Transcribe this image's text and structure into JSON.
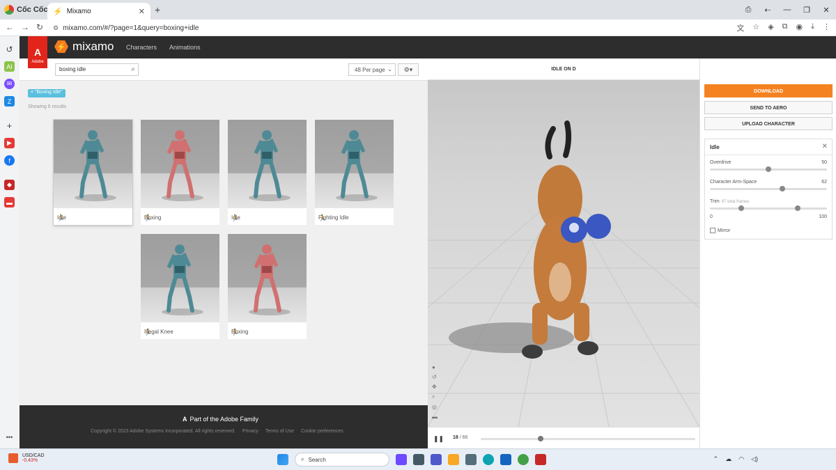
{
  "browser": {
    "brand": "Cốc Cốc",
    "tab_title": "Mixamo",
    "url": "mixamo.com/#/?page=1&query=boxing+idle"
  },
  "mixamo": {
    "adobe_label": "Adobe",
    "logo_text": "mixamo",
    "nav": [
      "Characters",
      "Animations"
    ]
  },
  "search": {
    "query": "boxing idle",
    "per_page": "48 Per page",
    "filter_chip": "× \"Boxing Idle\"",
    "result_count": "Showing 6 results"
  },
  "results": [
    {
      "label": "Idle",
      "tone": "teal"
    },
    {
      "label": "Boxing",
      "tone": "red"
    },
    {
      "label": "Idle",
      "tone": "teal"
    },
    {
      "label": "Fighting Idle",
      "tone": "teal"
    },
    {
      "label": "Illegal Knee",
      "tone": "teal"
    },
    {
      "label": "Boxing",
      "tone": "red"
    }
  ],
  "footer": {
    "family": "Part of the Adobe Family",
    "copyright": "Copyright © 2023 Adobe Systems Incorporated. All rights reserved.",
    "links": [
      "Privacy",
      "Terms of Use",
      "Cookie preferences"
    ]
  },
  "viewer": {
    "title": "IDLE ON D",
    "frame_current": "18",
    "frame_total": "/ 66",
    "progress": 0.28
  },
  "actions": {
    "download": "DOWNLOAD",
    "send": "SEND TO AERO",
    "upload": "UPLOAD CHARACTER"
  },
  "params": {
    "title": "Idle",
    "overdrive_label": "Overdrive",
    "overdrive_value": "50",
    "overdrive_fraction": 0.5,
    "armspace_label": "Character Arm-Space",
    "armspace_value": "62",
    "armspace_fraction": 0.62,
    "trim_label": "Trim",
    "trim_sub": "87 total frames",
    "trim_min": "0",
    "trim_max": "100",
    "trim_start_fraction": 0.27,
    "trim_end_fraction": 0.75,
    "mirror_label": "Mirror"
  },
  "taskbar": {
    "ticker": "USD/CAD",
    "ticker_change": "-0.43%",
    "search_placeholder": "Search"
  },
  "colors": {
    "accent_orange": "#f58220",
    "chip_blue": "#5bc0de",
    "header_dark": "#2d2d2d"
  }
}
